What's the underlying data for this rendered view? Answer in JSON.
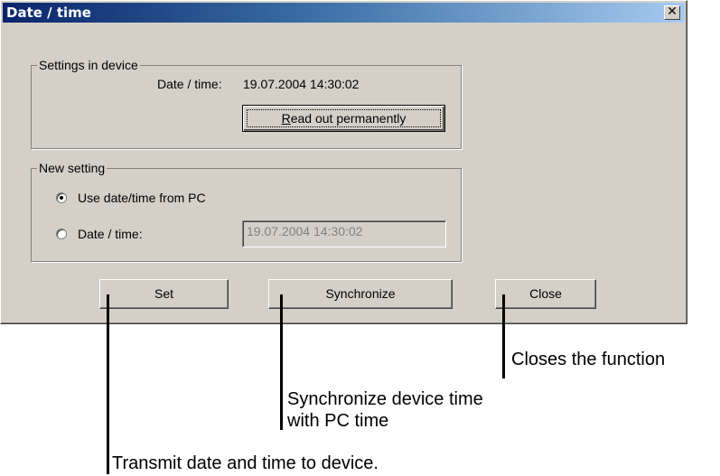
{
  "window": {
    "title": "Date / time",
    "close_glyph": "✕"
  },
  "device_settings": {
    "legend": "Settings in device",
    "date_time_label": "Date / time:",
    "date_time_value": "19.07.2004 14:30:02",
    "read_out_button_accel": "R",
    "read_out_button_rest": "ead out permanently"
  },
  "new_setting": {
    "legend": "New setting",
    "option_pc": "Use date/time from PC",
    "option_manual": "Date / time:",
    "manual_value": "19.07.2004 14:30:02",
    "selected": "option_pc"
  },
  "buttons": {
    "set": "Set",
    "synchronize": "Synchronize",
    "close": "Close"
  },
  "annotations": {
    "close": "Closes the function",
    "sync_line1": "Synchronize device time",
    "sync_line2": "with PC time",
    "set": "Transmit date and time to device."
  }
}
